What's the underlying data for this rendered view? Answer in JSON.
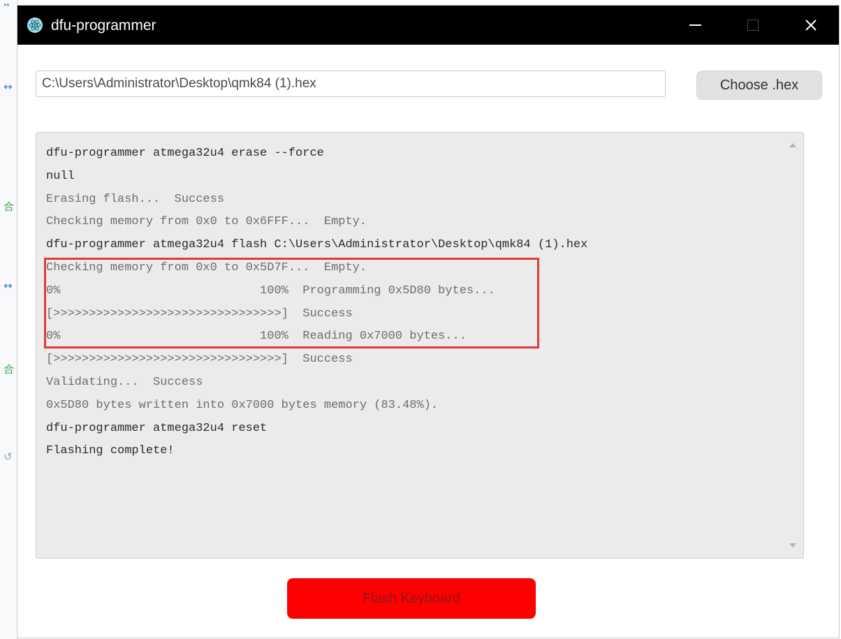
{
  "background": {
    "glyphs": [
      "↔",
      "↔",
      "合",
      "↔",
      "合",
      "↺"
    ]
  },
  "window": {
    "title": "dfu-programmer",
    "icon": "electron-atom-icon",
    "controls": [
      "minimize-icon",
      "maximize-icon",
      "close-icon"
    ],
    "close_glyph": "✕"
  },
  "file": {
    "path": "C:\\Users\\Administrator\\Desktop\\qmk84 (1).hex",
    "choose_label": "Choose .hex"
  },
  "log": {
    "lines": [
      {
        "text": "dfu-programmer atmega32u4 erase --force",
        "kind": "cmd"
      },
      {
        "text": "null",
        "kind": "cmd"
      },
      {
        "text": "Erasing flash...  Success",
        "kind": "out"
      },
      {
        "text": "Checking memory from 0x0 to 0x6FFF...  Empty.",
        "kind": "out"
      },
      {
        "text": "dfu-programmer atmega32u4 flash C:\\Users\\Administrator\\Desktop\\qmk84 (1).hex",
        "kind": "cmd"
      },
      {
        "text": "Checking memory from 0x0 to 0x5D7F...  Empty.",
        "kind": "out"
      },
      {
        "text": "0%                            100%  Programming 0x5D80 bytes...",
        "kind": "out"
      },
      {
        "text": "[>>>>>>>>>>>>>>>>>>>>>>>>>>>>>>>>]  Success",
        "kind": "out"
      },
      {
        "text": "0%                            100%  Reading 0x7000 bytes...",
        "kind": "out"
      },
      {
        "text": "[>>>>>>>>>>>>>>>>>>>>>>>>>>>>>>>>]  Success",
        "kind": "out"
      },
      {
        "text": "Validating...  Success",
        "kind": "out"
      },
      {
        "text": "0x5D80 bytes written into 0x7000 bytes memory (83.48%).",
        "kind": "out"
      },
      {
        "text": "dfu-programmer atmega32u4 reset",
        "kind": "cmd"
      },
      {
        "text": "Flashing complete!",
        "kind": "cmd"
      }
    ]
  },
  "flash_button_label": "Flash Keyboard",
  "colors": {
    "titlebar": "#000000",
    "flash_button": "#ff0000",
    "highlight": "#e03a3a",
    "log_background": "#ebebeb"
  }
}
